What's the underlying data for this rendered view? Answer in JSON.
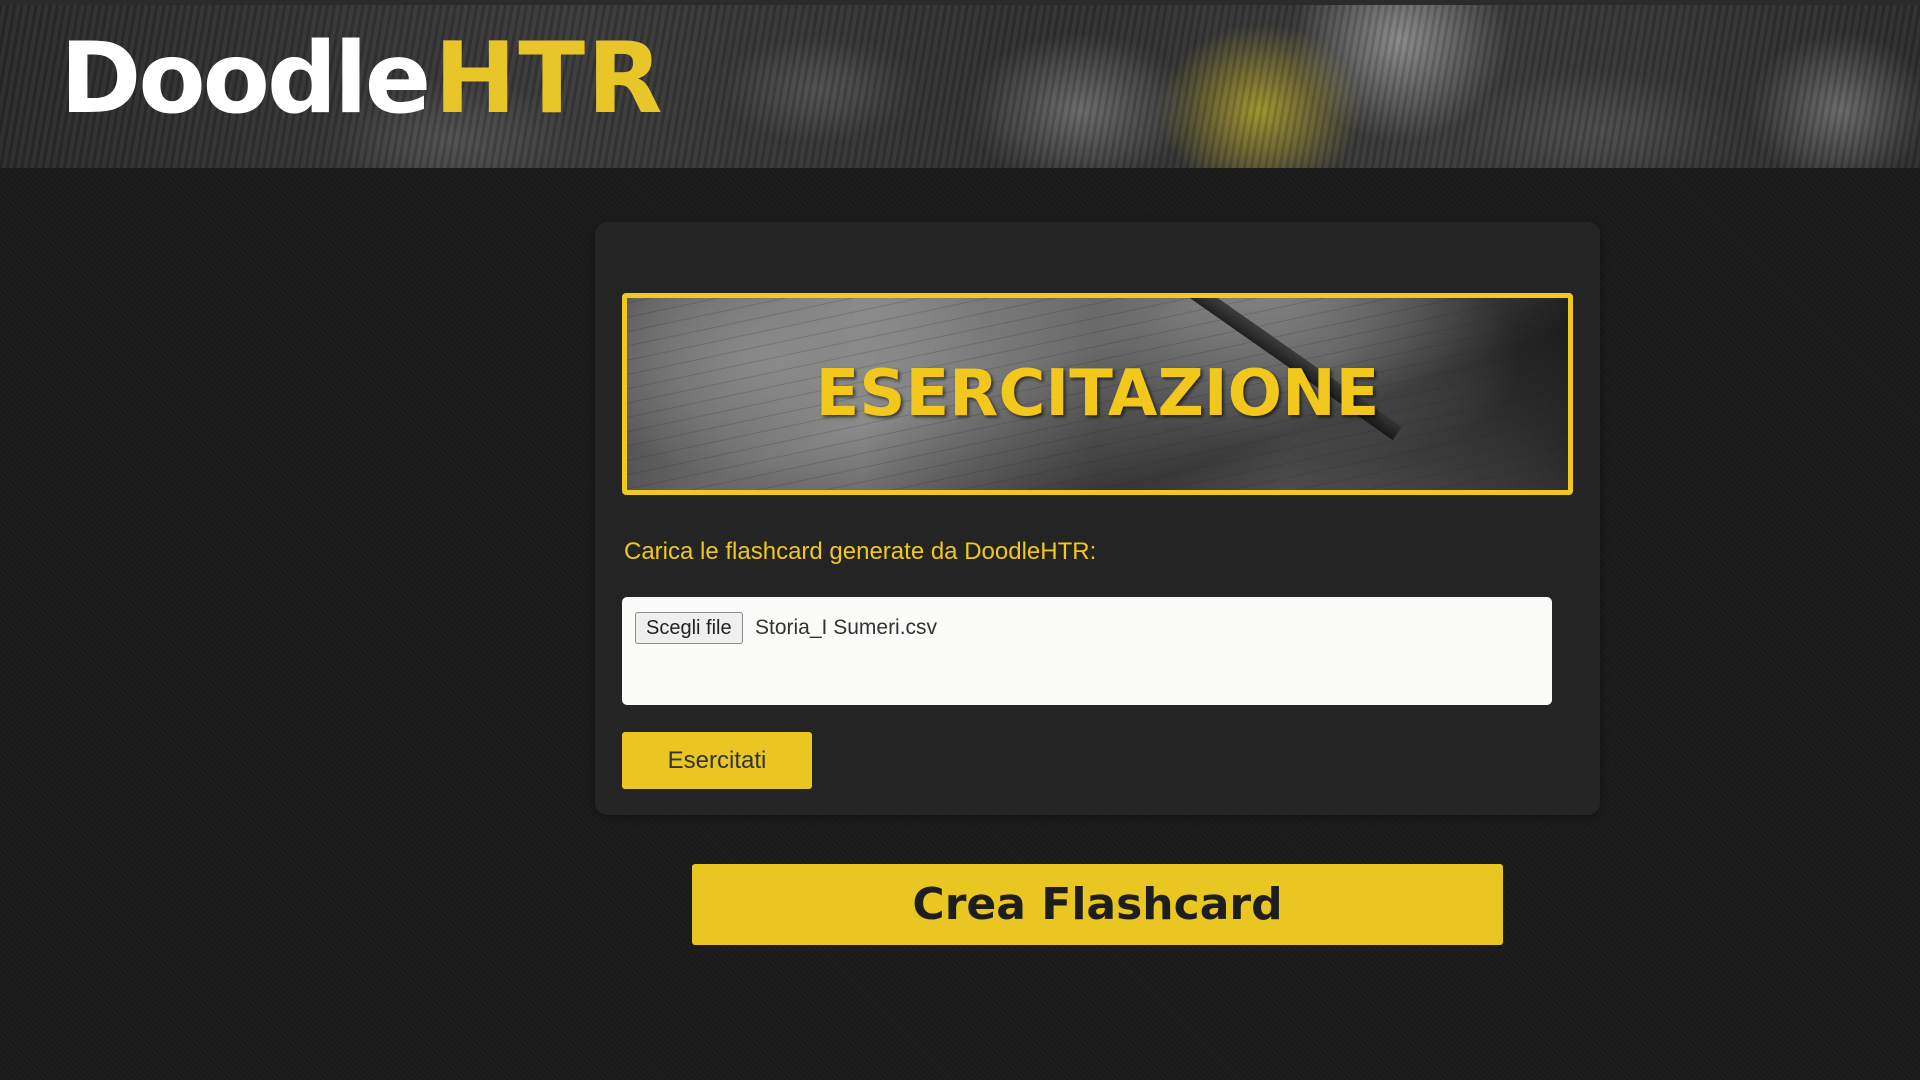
{
  "header": {
    "logo_part1": "Doodle",
    "logo_part2": "HTR"
  },
  "card": {
    "banner_title": "ESERCITAZIONE",
    "upload_label": "Carica le flashcard generate da DoodleHTR:",
    "file_input": {
      "button_label": "Scegli file",
      "selected_file": "Storia_I Sumeri.csv"
    },
    "practice_button_label": "Esercitati"
  },
  "create_button_label": "Crea Flashcard",
  "colors": {
    "accent": "#eac622",
    "background": "#1b1b1b",
    "card": "#242424"
  }
}
